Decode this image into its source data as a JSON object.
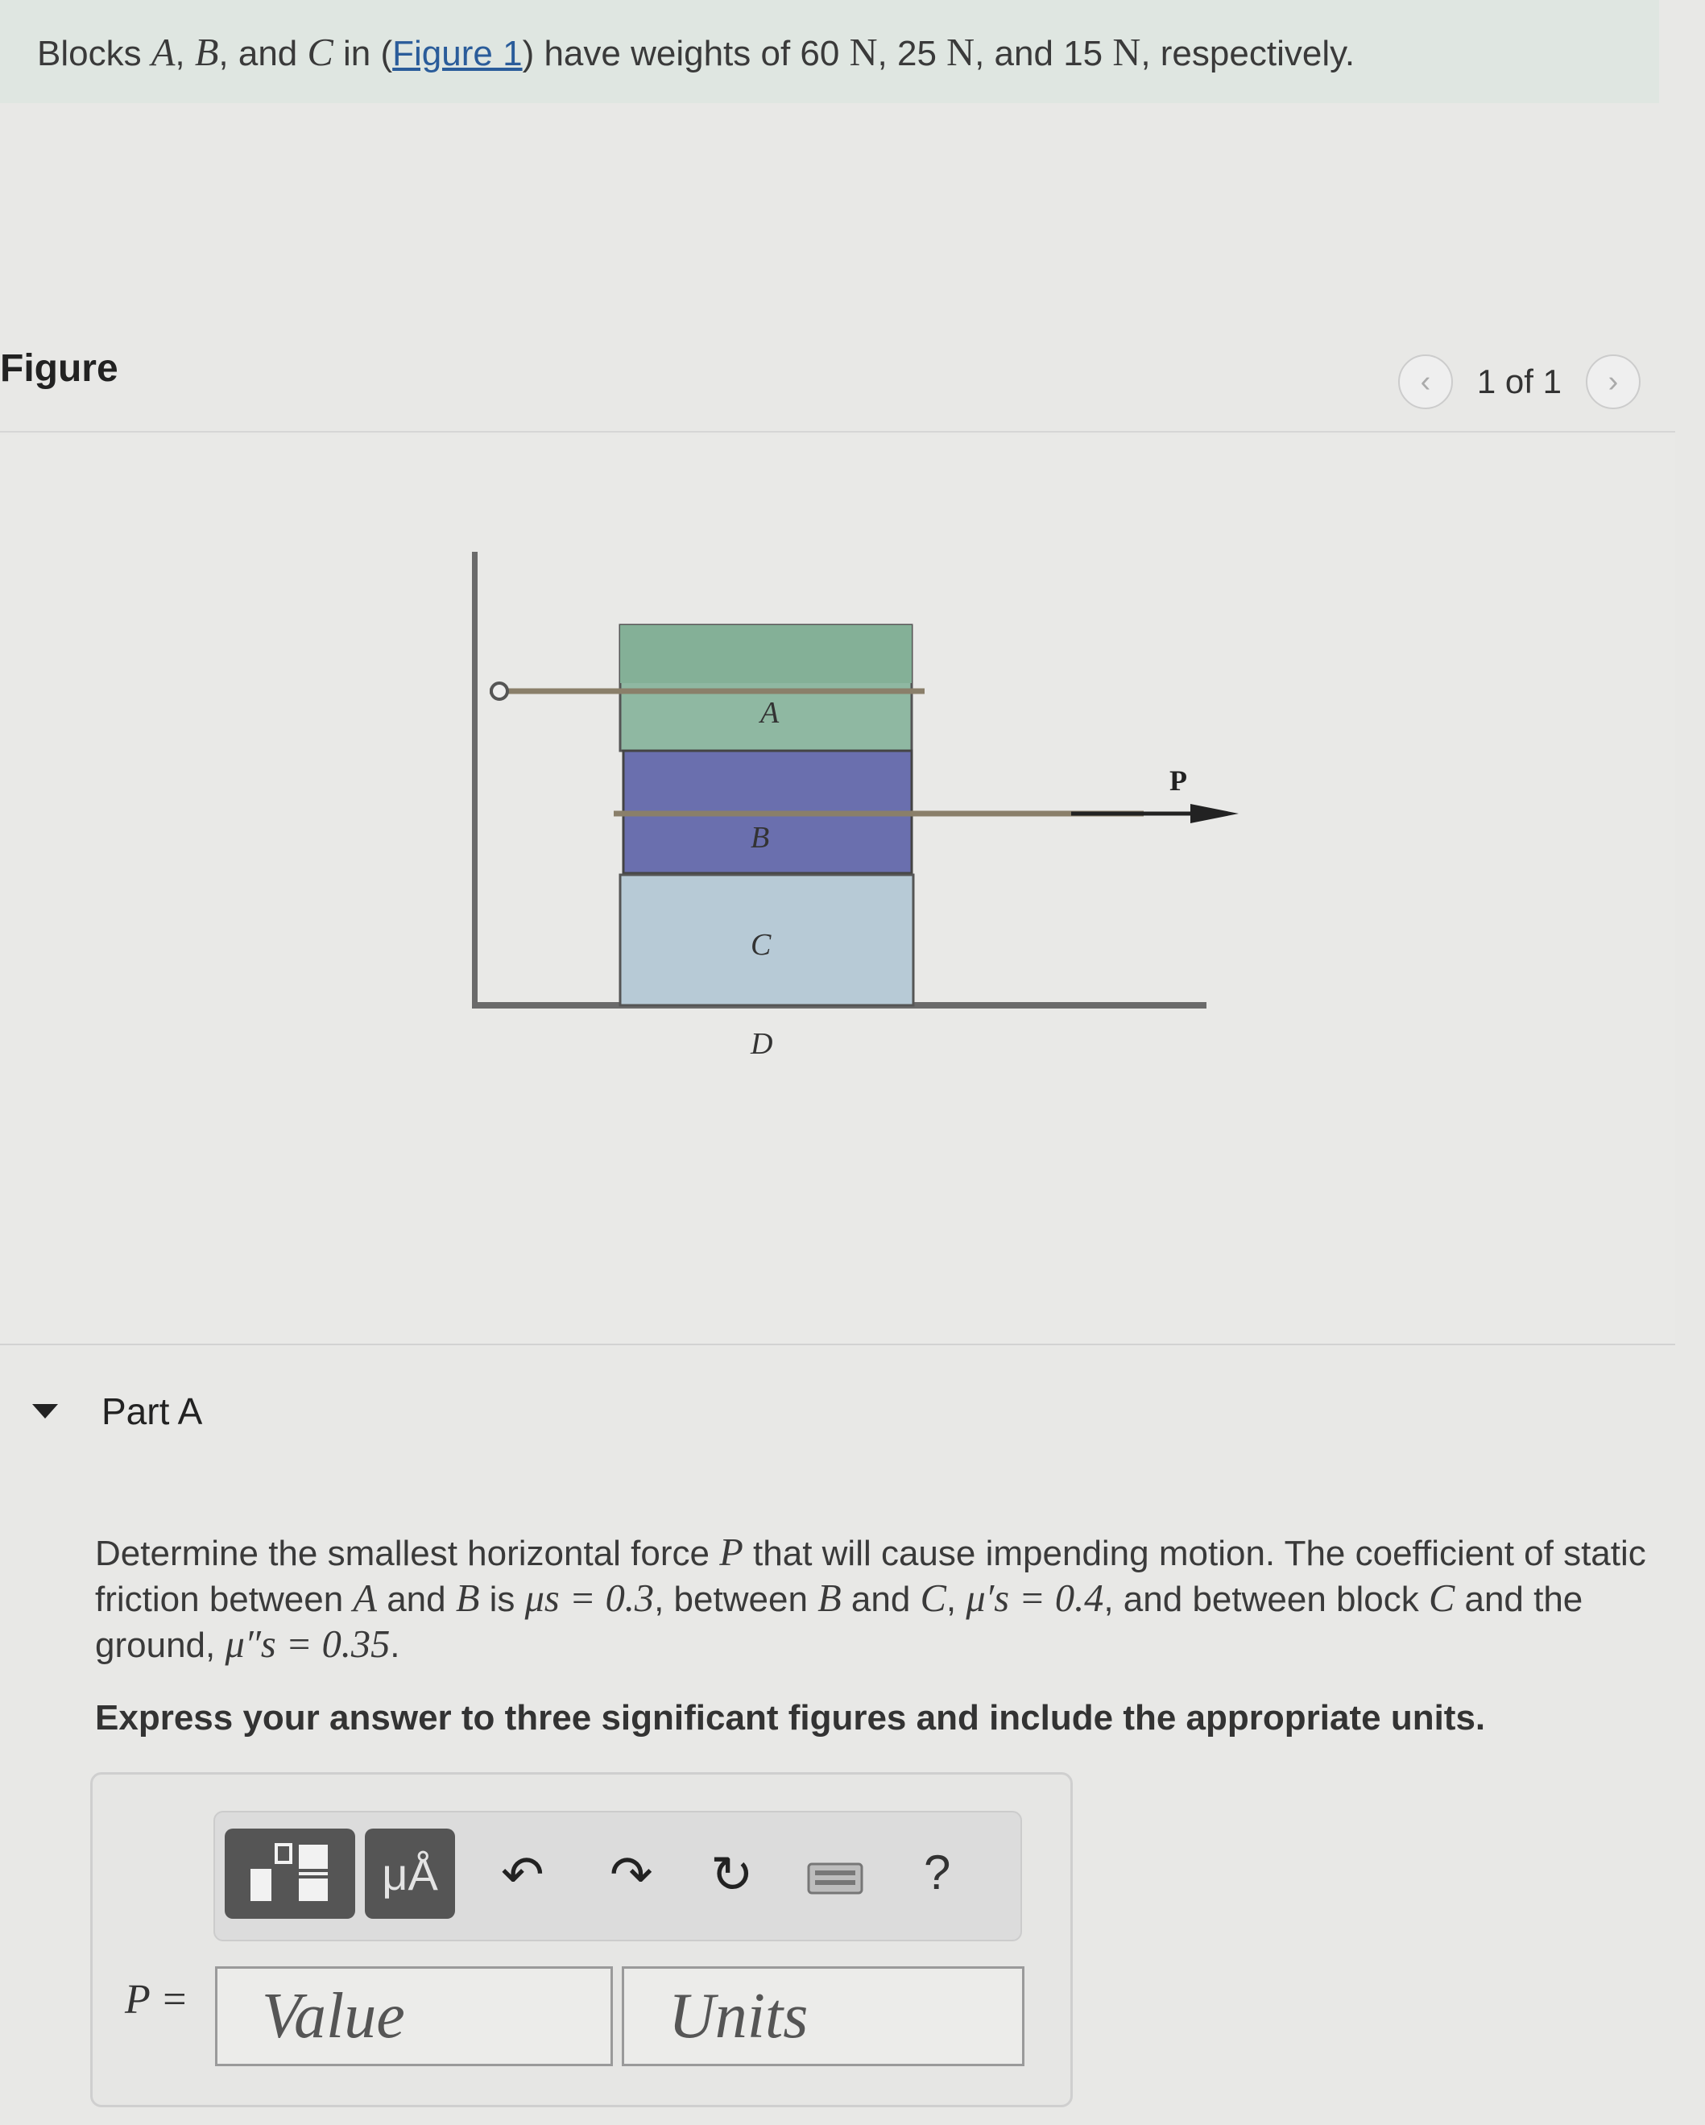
{
  "intro": {
    "text_1": "Blocks ",
    "block_a": "A",
    "sep_1": ", ",
    "block_b": "B",
    "sep_2": ", and ",
    "block_c": "C",
    "text_2": " in (",
    "figure_link": "Figure 1",
    "text_3": ") have weights of 60 ",
    "unit_1": "N",
    "text_4": ", 25 ",
    "unit_2": "N",
    "text_5": ", and 15 ",
    "unit_3": "N",
    "text_6": ", respectively."
  },
  "figure": {
    "heading": "Figure",
    "pager": "1 of 1",
    "prev_icon": "chevron-left-icon",
    "next_icon": "chevron-right-icon",
    "labels": {
      "a": "A",
      "b": "B",
      "c": "C",
      "d": "D",
      "p": "P"
    },
    "colors": {
      "block_a": "#8fb8a2",
      "block_b": "#6a6fae",
      "block_c": "#b7cad6",
      "rope": "#8a7f6a"
    }
  },
  "part_a": {
    "label": "Part A",
    "q_1": "Determine the smallest horizontal force ",
    "q_P": "P",
    "q_2": " that will cause impending motion. The coefficient of static friction between ",
    "q_A": "A",
    "q_3": " and ",
    "q_B": "B",
    "q_4": " is ",
    "mu1": "μs = 0.3",
    "q_5": ", between ",
    "q_B2": "B",
    "q_6": " and ",
    "q_C": "C",
    "q_7": ", ",
    "mu2": "μ′s = 0.4",
    "q_8": ", and between block ",
    "q_C2": "C",
    "q_9": " and the ground, ",
    "mu3": "μ″s = 0.35",
    "q_10": ".",
    "instruction": "Express your answer to three significant figures and include the appropriate units."
  },
  "answer": {
    "label": "P =",
    "value_placeholder": "Value",
    "units_placeholder": "Units",
    "units_button": "μÅ",
    "help": "?",
    "tools": [
      "templates-icon",
      "units-icon",
      "undo-icon",
      "redo-icon",
      "reset-icon",
      "keyboard-icon",
      "help-icon"
    ]
  }
}
